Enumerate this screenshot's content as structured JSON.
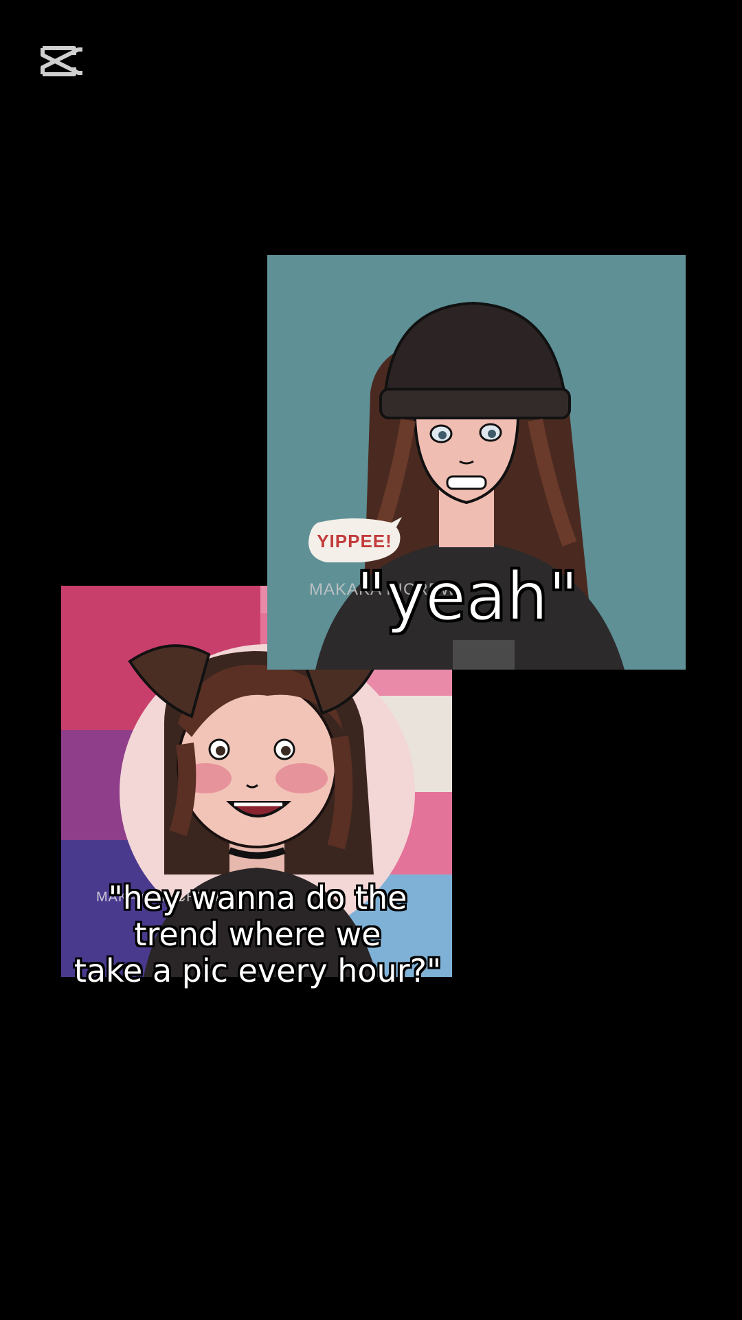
{
  "app": {
    "logo_icon": "capcut-logo-icon"
  },
  "cards": {
    "right": {
      "background": "#5e9096",
      "speech_bubble_text": "YIPPEE!",
      "watermark": "MAKAKA PICREW",
      "caption": "\"yeah\""
    },
    "left": {
      "flag_colors": [
        "#c93f6c",
        "#8f3f8a",
        "#4a3a8e",
        "#e88aa8",
        "#e9e3dc",
        "#e4739a",
        "#7fb1d6"
      ],
      "watermark": "MAKAKA PICREW",
      "caption": "\"hey wanna do the\ntrend where we\ntake a pic every hour?\""
    }
  }
}
